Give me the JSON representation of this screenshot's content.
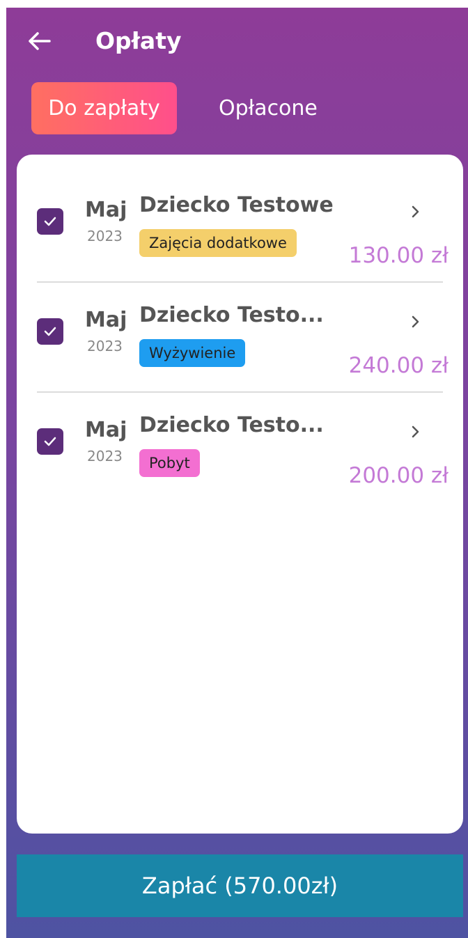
{
  "header": {
    "title": "Opłaty"
  },
  "tabs": [
    {
      "label": "Do zapłaty",
      "active": true
    },
    {
      "label": "Opłacone",
      "active": false
    }
  ],
  "payments": [
    {
      "month": "Maj",
      "year": "2023",
      "name": "Dziecko Testowe",
      "category": "Zajęcia dodatkowe",
      "category_color": "#f4cf6b",
      "amount": "130.00 zł",
      "checked": true
    },
    {
      "month": "Maj",
      "year": "2023",
      "name": "Dziecko Testo...",
      "category": "Wyżywienie",
      "category_color": "#1e9df0",
      "amount": "240.00 zł",
      "checked": true
    },
    {
      "month": "Maj",
      "year": "2023",
      "name": "Dziecko Testo...",
      "category": "Pobyt",
      "category_color": "#f36fd1",
      "amount": "200.00 zł",
      "checked": true
    }
  ],
  "pay_button": {
    "label": "Zapłać (570.00zł)"
  },
  "colors": {
    "accent_gradient_start": "#ff6f61",
    "accent_gradient_end": "#ff4f8b",
    "background_top": "#8e3c98",
    "background_bottom": "#4e53a2",
    "checkbox": "#5c2d7a",
    "amount": "#c47ad6",
    "pay_button": "#1a86a8"
  },
  "icons": {
    "back": "arrow-left-icon",
    "row_action": "chevron-right-icon",
    "checkbox": "check-icon"
  }
}
